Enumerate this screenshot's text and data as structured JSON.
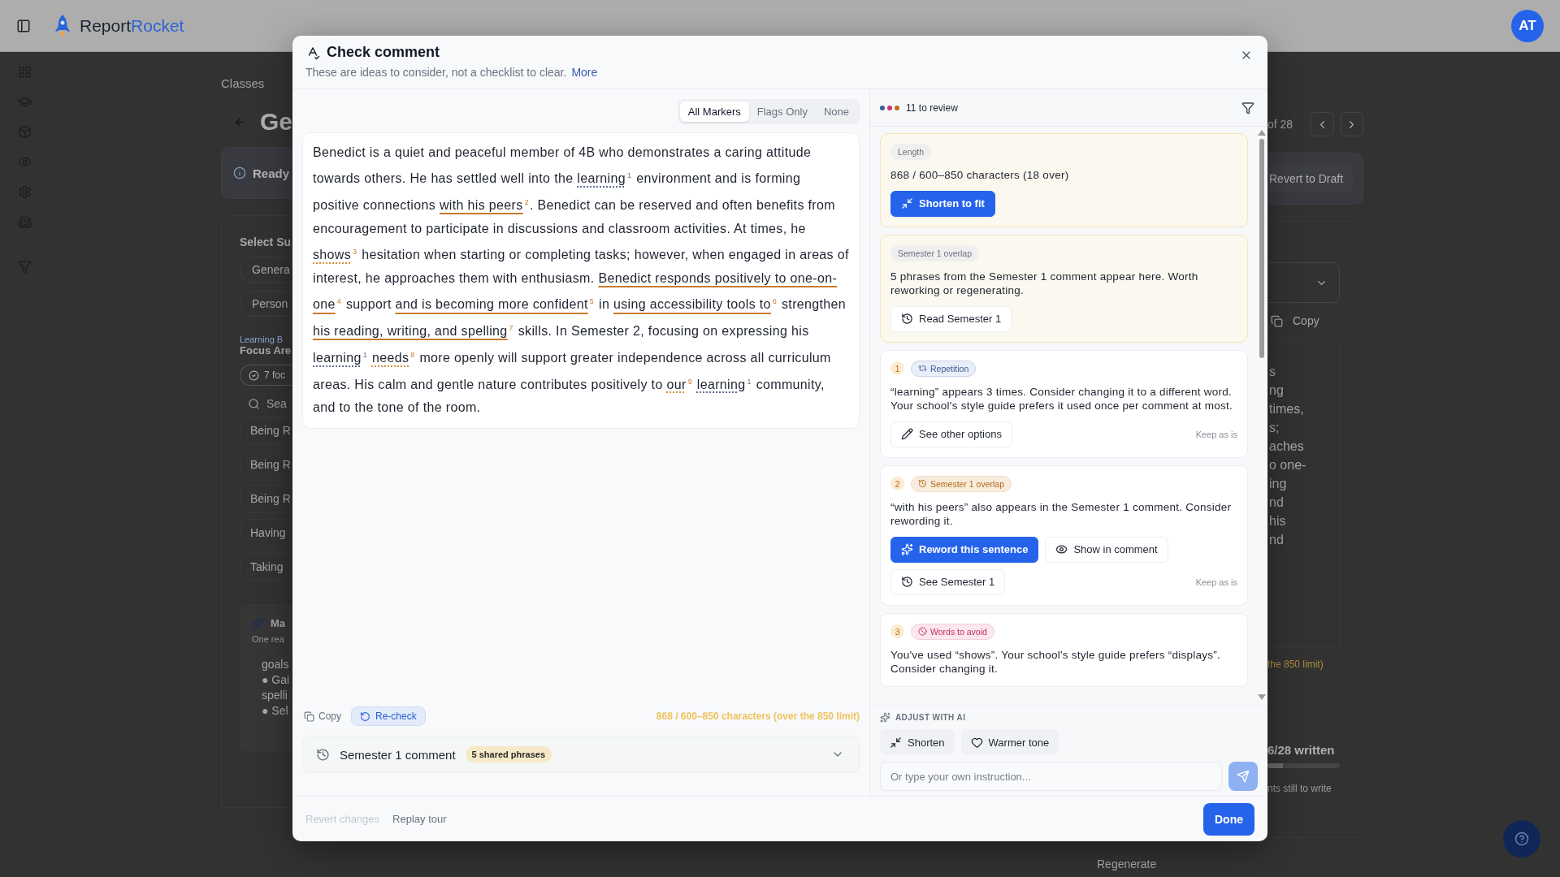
{
  "header": {
    "brand_first": "Report",
    "brand_second": "Rocket",
    "avatar": "AT"
  },
  "background_left": {
    "breadcrumb": "Classes",
    "title": "Ge",
    "banner": "Ready",
    "panel_title": "Select Su",
    "chips": [
      "Genera",
      "Person"
    ],
    "section_label": "Learning B",
    "section_title": "Focus Are",
    "focus_badge": "7 foc",
    "search_placeholder": "Sea",
    "rows": [
      "Being R",
      "Being R",
      "Being R",
      "Having",
      "Taking"
    ],
    "ai_card": {
      "title": "Ma",
      "subtitle": "One rea",
      "lines": [
        "goals",
        "● Gai",
        "spelli",
        "● Sel"
      ]
    }
  },
  "background_right": {
    "counter": "of 28",
    "revert": "Revert to Draft",
    "copy": "Copy",
    "text_lines": [
      "s",
      "ng",
      "times,",
      "s;",
      "aches",
      "o one-",
      "ing",
      "nd",
      "his",
      "nd"
    ],
    "limit_note": "the 850 limit)",
    "progress": {
      "label": "6/28 written",
      "level": 0.21
    },
    "still_to_write": "nts still to write",
    "regenerate": "Regenerate"
  },
  "dialog": {
    "title": "Check comment",
    "subtitle": "These are ideas to consider, not a checklist to clear.",
    "more_link": "More",
    "tabs": [
      {
        "label": "All Markers",
        "selected": true
      },
      {
        "label": "Flags Only",
        "selected": false
      },
      {
        "label": "None",
        "selected": false
      }
    ],
    "comment": [
      {
        "text": "Benedict is a quiet and peaceful member of 4B who demonstrates a caring attitude towards others. He has settled well into the "
      },
      {
        "text": "learning",
        "marker": "1",
        "kind": "repetition"
      },
      {
        "text": " environment and is forming positive connections "
      },
      {
        "text": "with his peers",
        "marker": "2",
        "kind": "overlap"
      },
      {
        "text": ". Benedict can be reserved and often benefits from encouragement to participate in discussions and classroom activities. At times, he "
      },
      {
        "text": "shows",
        "marker": "3",
        "kind": "avoid"
      },
      {
        "text": " hesitation when starting or completing tasks; however, when engaged in areas of interest, he approaches them with enthusiasm. "
      },
      {
        "text": "Benedict responds positively to one-on-one",
        "marker": "4",
        "kind": "overlap"
      },
      {
        "text": " support "
      },
      {
        "text": "and is becoming more confident",
        "marker": "5",
        "kind": "overlap"
      },
      {
        "text": " in "
      },
      {
        "text": "using accessibility tools to",
        "marker": "6",
        "kind": "overlap"
      },
      {
        "text": " strengthen "
      },
      {
        "text": "his reading, writing, and spelling",
        "marker": "7",
        "kind": "overlap"
      },
      {
        "text": " skills. In Semester 2, focusing on expressing his "
      },
      {
        "text": "learning",
        "marker": "1",
        "kind": "repetition"
      },
      {
        "text": "needs",
        "marker": "8",
        "kind": "avoid"
      },
      {
        "text": " more openly will support greater independence across all curriculum areas. His calm and gentle nature contributes positively to "
      },
      {
        "text": "our",
        "marker": "9",
        "kind": "avoid"
      },
      {
        "text": "learning",
        "marker": "1",
        "kind": "repetition"
      },
      {
        "text": " community, and to the tone of the room."
      }
    ],
    "copy": "Copy",
    "recheck": "Re-check",
    "char_count": "868 / 600–850 characters (over the 850 limit)",
    "semester_panel": {
      "title": "Semester 1 comment",
      "badge": "5 shared phrases",
      "expanded": false
    },
    "review": {
      "legend": [
        {
          "color": "#3d5a9e"
        },
        {
          "color": "#d1336b"
        },
        {
          "color": "#c2691d"
        }
      ],
      "count": "11 to review",
      "cards": [
        {
          "kind": "notice",
          "tag": {
            "label": "Length",
            "kind": "plain"
          },
          "text": "868 / 600–850 characters (18 over)",
          "actions": [
            {
              "label": "Shorten to fit",
              "kind": "shorten",
              "primary": true
            }
          ]
        },
        {
          "kind": "notice",
          "tag": {
            "label": "Semester 1 overlap",
            "kind": "plain"
          },
          "text": "5 phrases from the Semester 1 comment appear here. Worth reworking or regenerating.",
          "actions": [
            {
              "label": "Read Semester 1",
              "kind": "history",
              "primary": false
            }
          ]
        },
        {
          "kind": "issue",
          "number": "1",
          "tag": {
            "label": "Repetition",
            "kind": "repetition"
          },
          "text": "“learning” appears 3 times. Consider changing it to a different word. Your school's style guide prefers it used once per comment at most.",
          "actions": [
            {
              "label": "See other options",
              "kind": "edit",
              "primary": false
            }
          ],
          "dismiss": "Keep as is"
        },
        {
          "kind": "issue",
          "number": "2",
          "tag": {
            "label": "Semester 1 overlap",
            "kind": "overlap"
          },
          "text": "“with his peers” also appears in the Semester 1 comment. Consider rewording it.",
          "actions": [
            {
              "label": "Reword this sentence",
              "kind": "reword",
              "primary": true
            },
            {
              "label": "Show in comment",
              "kind": "show",
              "primary": false
            },
            {
              "label": "See Semester 1",
              "kind": "history",
              "primary": false
            }
          ],
          "dismiss": "Keep as is"
        },
        {
          "kind": "issue",
          "number": "3",
          "tag": {
            "label": "Words to avoid",
            "kind": "avoid"
          },
          "text": "You've used “shows”. Your school's style guide prefers “displays”. Consider changing it."
        }
      ]
    },
    "adjust": {
      "label": "ADJUST WITH AI",
      "chips": [
        {
          "label": "Shorten",
          "kind": "shorten"
        },
        {
          "label": "Warmer tone",
          "kind": "warmer"
        }
      ],
      "placeholder": "Or type your own instruction..."
    },
    "footer": {
      "buttons": [
        {
          "label": "Revert changes",
          "disabled": true
        },
        {
          "label": "Replay tour",
          "disabled": false
        }
      ],
      "done": "Done"
    }
  }
}
